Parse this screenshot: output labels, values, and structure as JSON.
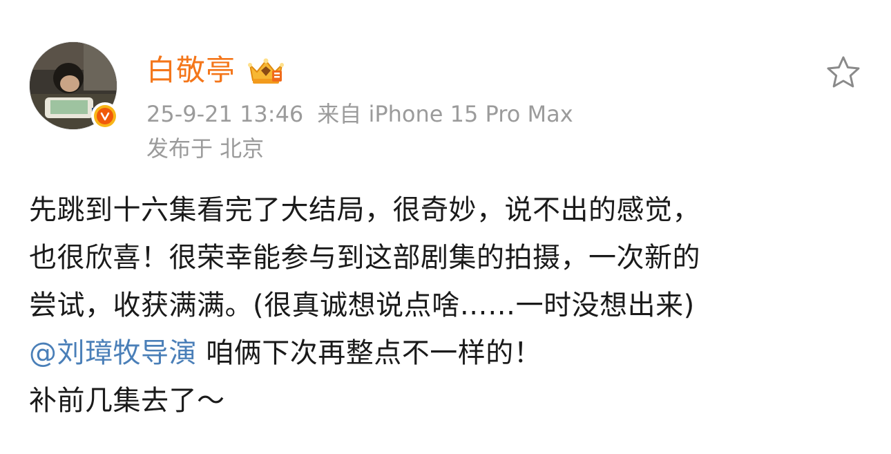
{
  "author": {
    "name": "白敬亭",
    "verified_icon": "verified-v-icon",
    "vip_icon": "crown-vip-icon",
    "brand_color": "#f4761a"
  },
  "meta": {
    "time": "25-9-21 13:46",
    "source": "来自 iPhone 15 Pro Max",
    "location": "发布于 北京"
  },
  "actions": {
    "favorite_icon": "star-icon"
  },
  "post": {
    "lines": [
      "先跳到十六集看完了大结局，很奇妙，说不出的感觉，",
      "也很欣喜！很荣幸能参与到这部剧集的拍摄，一次新的",
      "尝试，收获满满。(很真诚想说点啥……一时没想出来)"
    ],
    "mention": "@刘璋牧导演",
    "mention_rest": " 咱俩下次再整点不一样的！",
    "last_line": "补前几集去了～",
    "mention_color": "#4a7fb8"
  }
}
